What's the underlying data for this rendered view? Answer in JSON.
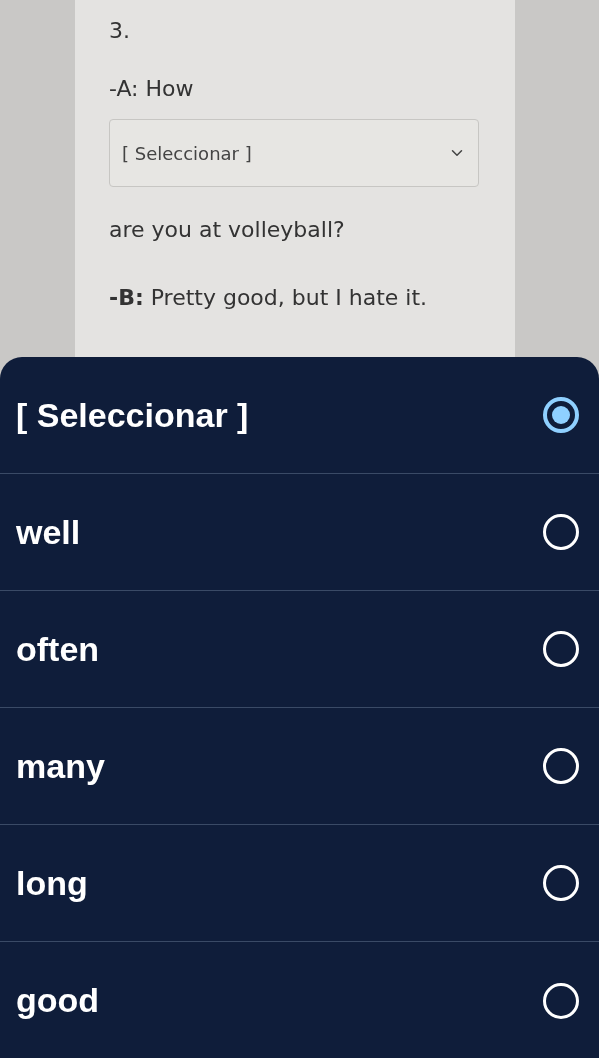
{
  "question": {
    "number": "3.",
    "line_a": "-A: How",
    "select": {
      "value": "[ Seleccionar ]"
    },
    "after_select": "are you at volleyball?",
    "line_b": "**-B:** Pretty good, but I hate it."
  },
  "picker": {
    "options": [
      {
        "label": "[ Seleccionar ]",
        "selected": true
      },
      {
        "label": "well",
        "selected": false
      },
      {
        "label": "often",
        "selected": false
      },
      {
        "label": "many",
        "selected": false
      },
      {
        "label": "long",
        "selected": false
      },
      {
        "label": "good",
        "selected": false
      }
    ]
  }
}
